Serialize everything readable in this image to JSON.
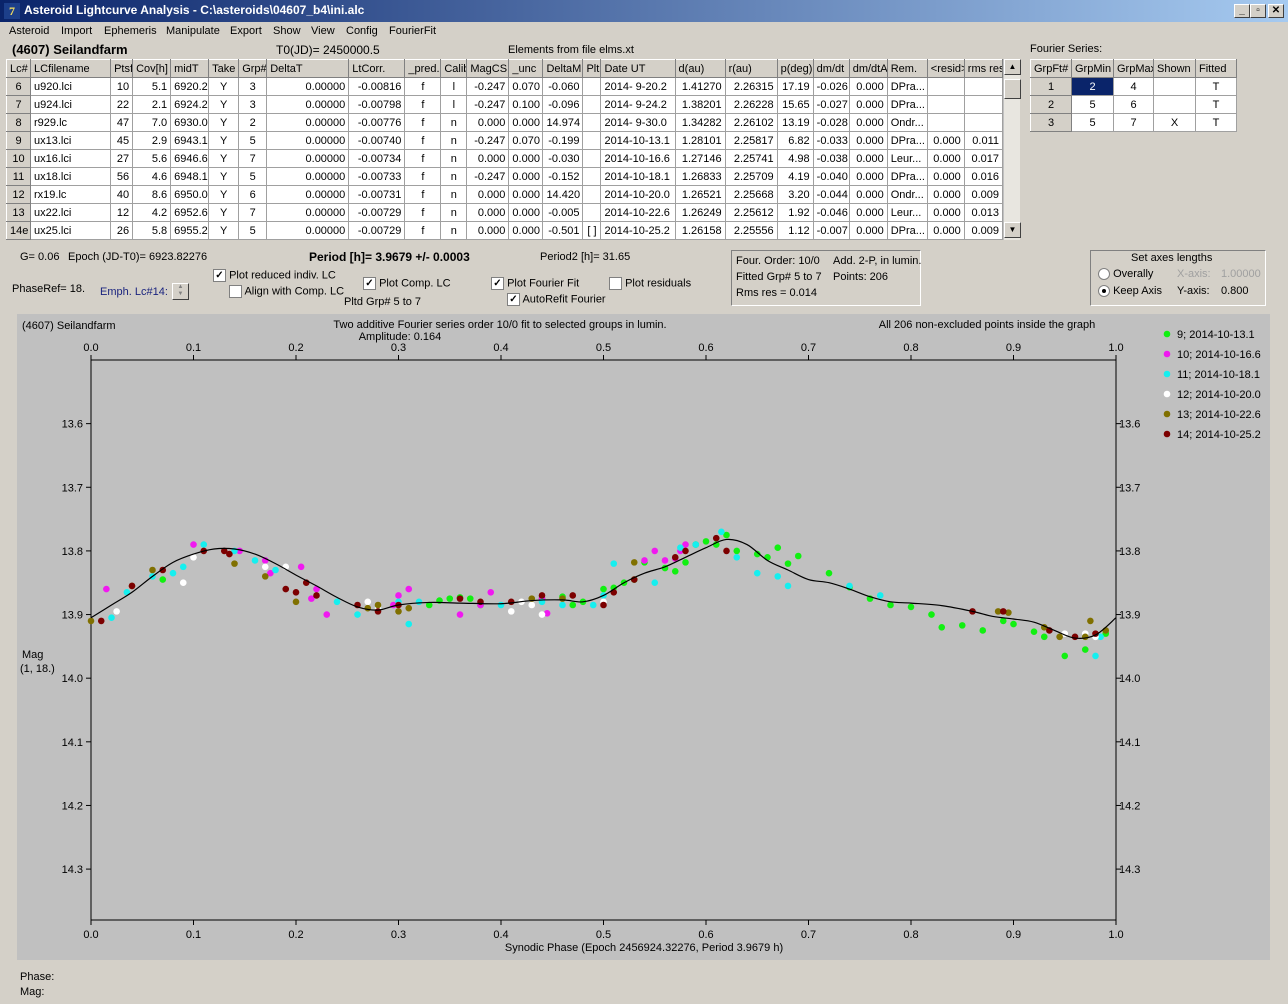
{
  "window": {
    "title": "Asteroid Lightcurve Analysis - C:\\asteroids\\04607_b4\\ini.alc",
    "icon_label": "7",
    "icon_name": "app-logo-icon",
    "controls": [
      "_",
      "▫",
      "✕"
    ]
  },
  "menu": [
    "Asteroid",
    "Import",
    "Ephemeris",
    "Manipulate",
    "Export",
    "Show",
    "View",
    "Config",
    "FourierFit"
  ],
  "header": {
    "asteroid": "(4607) Seilandfarm",
    "t0": "T0(JD)= 2450000.5",
    "elements": "Elements from file elms.xt",
    "fourier_title": "Fourier Series:"
  },
  "lc_table": {
    "columns": [
      "Lc#",
      "LCfilename",
      "Ptsf",
      "Cov[h]",
      "midT",
      "Take",
      "Grp#",
      "DeltaT",
      "LtCorr.",
      "_pred.",
      "Calib",
      "MagCS",
      "_unc",
      "DeltaM",
      "Plt",
      "Date UT",
      "d(au)",
      "r(au)",
      "p(deg)",
      "dm/dt",
      "dm/dtA",
      "Rem.",
      "<resid>",
      "rms res"
    ],
    "rows": [
      [
        "6",
        "u920.lci",
        "10",
        "5.1",
        "6920.2",
        "Y",
        "3",
        "0.00000",
        "-0.00816",
        "f",
        "l",
        "-0.247",
        "0.070",
        "-0.060",
        "",
        "2014- 9-20.2",
        "1.41270",
        "2.26315",
        "17.19",
        "-0.026",
        "0.000",
        "DPra...",
        "",
        ""
      ],
      [
        "7",
        "u924.lci",
        "22",
        "2.1",
        "6924.2",
        "Y",
        "3",
        "0.00000",
        "-0.00798",
        "f",
        "l",
        "-0.247",
        "0.100",
        "-0.096",
        "",
        "2014- 9-24.2",
        "1.38201",
        "2.26228",
        "15.65",
        "-0.027",
        "0.000",
        "DPra...",
        "",
        ""
      ],
      [
        "8",
        "r929.lc",
        "47",
        "7.0",
        "6930.0",
        "Y",
        "2",
        "0.00000",
        "-0.00776",
        "f",
        "n",
        "0.000",
        "0.000",
        "14.974",
        "",
        "2014- 9-30.0",
        "1.34282",
        "2.26102",
        "13.19",
        "-0.028",
        "0.000",
        "Ondr...",
        "",
        ""
      ],
      [
        "9",
        "ux13.lci",
        "45",
        "2.9",
        "6943.1",
        "Y",
        "5",
        "0.00000",
        "-0.00740",
        "f",
        "n",
        "-0.247",
        "0.070",
        "-0.199",
        "",
        "2014-10-13.1",
        "1.28101",
        "2.25817",
        "6.82",
        "-0.033",
        "0.000",
        "DPra...",
        "0.000",
        "0.011"
      ],
      [
        "10",
        "ux16.lci",
        "27",
        "5.6",
        "6946.6",
        "Y",
        "7",
        "0.00000",
        "-0.00734",
        "f",
        "n",
        "0.000",
        "0.000",
        "-0.030",
        "",
        "2014-10-16.6",
        "1.27146",
        "2.25741",
        "4.98",
        "-0.038",
        "0.000",
        "Leur...",
        "0.000",
        "0.017"
      ],
      [
        "11",
        "ux18.lci",
        "56",
        "4.6",
        "6948.1",
        "Y",
        "5",
        "0.00000",
        "-0.00733",
        "f",
        "n",
        "-0.247",
        "0.000",
        "-0.152",
        "",
        "2014-10-18.1",
        "1.26833",
        "2.25709",
        "4.19",
        "-0.040",
        "0.000",
        "DPra...",
        "0.000",
        "0.016"
      ],
      [
        "12",
        "rx19.lc",
        "40",
        "8.6",
        "6950.0",
        "Y",
        "6",
        "0.00000",
        "-0.00731",
        "f",
        "n",
        "0.000",
        "0.000",
        "14.420",
        "",
        "2014-10-20.0",
        "1.26521",
        "2.25668",
        "3.20",
        "-0.044",
        "0.000",
        "Ondr...",
        "0.000",
        "0.009"
      ],
      [
        "13",
        "ux22.lci",
        "12",
        "4.2",
        "6952.6",
        "Y",
        "7",
        "0.00000",
        "-0.00729",
        "f",
        "n",
        "0.000",
        "0.000",
        "-0.005",
        "",
        "2014-10-22.6",
        "1.26249",
        "2.25612",
        "1.92",
        "-0.046",
        "0.000",
        "Leur...",
        "0.000",
        "0.013"
      ],
      [
        "14e",
        "ux25.lci",
        "26",
        "5.8",
        "6955.2",
        "Y",
        "5",
        "0.00000",
        "-0.00729",
        "f",
        "n",
        "0.000",
        "0.000",
        "-0.501",
        "[ ]",
        "2014-10-25.2",
        "1.26158",
        "2.25556",
        "1.12",
        "-0.007",
        "0.000",
        "DPra...",
        "0.000",
        "0.009"
      ]
    ]
  },
  "fourier_table": {
    "columns": [
      "GrpFt#",
      "GrpMin",
      "GrpMax",
      "Shown",
      "Fitted"
    ],
    "rows": [
      [
        "1",
        "2",
        "4",
        "",
        "T"
      ],
      [
        "2",
        "5",
        "6",
        "",
        "T"
      ],
      [
        "3",
        "5",
        "7",
        "X",
        "T"
      ]
    ]
  },
  "controls": {
    "g": "G= 0.06",
    "epoch": "Epoch (JD-T0)= 6923.82276",
    "period": "Period [h]= 3.9679 +/- 0.0003",
    "period2": "Period2 [h]= 31.65",
    "phase_ref": "PhaseRef= 18.",
    "emph_lc": "Emph. Lc#14:",
    "plot_reduced": "Plot reduced indiv. LC",
    "align_comp": "Align with Comp. LC",
    "plot_comp": "Plot Comp. LC",
    "pltd_grp": "Pltd Grp#  5  to  7",
    "plot_fourier": "Plot Fourier Fit",
    "autorefit": "AutoRefit Fourier",
    "plot_residuals": "Plot residuals",
    "checked": {
      "plot_reduced": true,
      "align_comp": false,
      "plot_comp": true,
      "plot_fourier": true,
      "autorefit": true,
      "plot_residuals": false
    },
    "check_mark": "✓",
    "fit_info": {
      "order": "Four. Order: 10/0",
      "add": "Add. 2-P, in lumin.",
      "fitted": "Fitted Grp# 5 to 7",
      "points": "Points: 206",
      "rms": "Rms res     = 0.014"
    },
    "axes": {
      "title": "Set axes lengths",
      "overally": "Overally",
      "keep": "Keep Axis",
      "selected": "keep",
      "x_label": "X-axis:",
      "x_value": "1.00000",
      "y_label": "Y-axis:",
      "y_value": "0.800"
    }
  },
  "chart_data": {
    "type": "scatter",
    "name_text": "(4607) Seilandfarm",
    "title": "Two additive Fourier series order 10/0 fit to selected groups in lumin.",
    "subtitle": "Amplitude: 0.164",
    "note": "All 206 non-excluded points inside the graph",
    "xlabel": "Synodic Phase (Epoch 2456924.32276, Period 3.9679 h)",
    "ylabel": "Mag",
    "ylabel2": "(1, 18.)",
    "xlim": [
      0.0,
      1.0
    ],
    "ylim": [
      13.5,
      14.38
    ],
    "y_inverted": true,
    "x_ticks": [
      "0.0",
      "0.1",
      "0.2",
      "0.3",
      "0.4",
      "0.5",
      "0.6",
      "0.7",
      "0.8",
      "0.9",
      "1.0"
    ],
    "y_ticks": [
      "13.6",
      "13.7",
      "13.8",
      "13.9",
      "14.0",
      "14.1",
      "14.2",
      "14.3"
    ],
    "grid": false,
    "legend_position": "right",
    "fit_curve": {
      "color": "#000000",
      "x": [
        0.0,
        0.02,
        0.04,
        0.06,
        0.08,
        0.1,
        0.12,
        0.14,
        0.16,
        0.18,
        0.2,
        0.22,
        0.24,
        0.26,
        0.28,
        0.3,
        0.33,
        0.36,
        0.4,
        0.43,
        0.46,
        0.48,
        0.5,
        0.52,
        0.54,
        0.56,
        0.58,
        0.6,
        0.62,
        0.64,
        0.66,
        0.68,
        0.7,
        0.72,
        0.74,
        0.76,
        0.78,
        0.8,
        0.83,
        0.86,
        0.88,
        0.9,
        0.92,
        0.94,
        0.96,
        0.98,
        1.0
      ],
      "y": [
        13.905,
        13.885,
        13.865,
        13.84,
        13.818,
        13.805,
        13.797,
        13.797,
        13.805,
        13.82,
        13.838,
        13.855,
        13.873,
        13.888,
        13.893,
        13.885,
        13.881,
        13.882,
        13.883,
        13.878,
        13.877,
        13.88,
        13.87,
        13.85,
        13.835,
        13.825,
        13.81,
        13.795,
        13.782,
        13.79,
        13.815,
        13.83,
        13.845,
        13.85,
        13.86,
        13.872,
        13.88,
        13.882,
        13.886,
        13.895,
        13.903,
        13.907,
        13.912,
        13.925,
        13.937,
        13.932,
        13.905
      ]
    },
    "series": [
      {
        "name": "9; 2014-10-13.1",
        "color": "#11f011",
        "x": [
          0.07,
          0.33,
          0.34,
          0.35,
          0.36,
          0.37,
          0.38,
          0.44,
          0.46,
          0.47,
          0.48,
          0.5,
          0.51,
          0.52,
          0.53,
          0.54,
          0.56,
          0.57,
          0.58,
          0.59,
          0.6,
          0.61,
          0.62,
          0.63,
          0.65,
          0.66,
          0.67,
          0.68,
          0.69,
          0.72,
          0.74,
          0.76,
          0.78,
          0.8,
          0.82,
          0.83,
          0.85,
          0.87,
          0.89,
          0.9,
          0.92,
          0.93,
          0.95,
          0.97,
          0.99
        ],
        "y": [
          13.845,
          13.885,
          13.878,
          13.875,
          13.873,
          13.875,
          13.885,
          13.875,
          13.872,
          13.885,
          13.88,
          13.86,
          13.858,
          13.85,
          13.845,
          13.818,
          13.827,
          13.832,
          13.818,
          13.79,
          13.785,
          13.79,
          13.775,
          13.8,
          13.805,
          13.81,
          13.795,
          13.82,
          13.808,
          13.835,
          13.857,
          13.875,
          13.885,
          13.888,
          13.9,
          13.92,
          13.917,
          13.925,
          13.91,
          13.915,
          13.927,
          13.935,
          13.965,
          13.955,
          13.93
        ]
      },
      {
        "name": "10; 2014-10-16.6",
        "color": "#f019f0",
        "x": [
          0.015,
          0.1,
          0.145,
          0.17,
          0.175,
          0.205,
          0.215,
          0.22,
          0.23,
          0.295,
          0.3,
          0.31,
          0.36,
          0.38,
          0.39,
          0.44,
          0.445,
          0.54,
          0.55,
          0.56,
          0.57,
          0.575,
          0.58
        ],
        "y": [
          13.86,
          13.79,
          13.8,
          13.815,
          13.835,
          13.825,
          13.875,
          13.86,
          13.9,
          13.885,
          13.87,
          13.86,
          13.9,
          13.885,
          13.865,
          13.875,
          13.898,
          13.815,
          13.8,
          13.815,
          13.812,
          13.8,
          13.79
        ]
      },
      {
        "name": "11; 2014-10-18.1",
        "color": "#15efef",
        "x": [
          0.02,
          0.035,
          0.06,
          0.08,
          0.09,
          0.11,
          0.14,
          0.16,
          0.18,
          0.24,
          0.26,
          0.28,
          0.3,
          0.31,
          0.32,
          0.4,
          0.44,
          0.46,
          0.49,
          0.5,
          0.51,
          0.55,
          0.575,
          0.59,
          0.61,
          0.615,
          0.63,
          0.65,
          0.67,
          0.68,
          0.74,
          0.77,
          0.98,
          0.985
        ],
        "y": [
          13.905,
          13.865,
          13.84,
          13.835,
          13.825,
          13.79,
          13.8,
          13.815,
          13.83,
          13.88,
          13.9,
          13.89,
          13.88,
          13.915,
          13.88,
          13.885,
          13.88,
          13.885,
          13.885,
          13.87,
          13.82,
          13.85,
          13.795,
          13.79,
          13.78,
          13.77,
          13.81,
          13.835,
          13.84,
          13.855,
          13.855,
          13.87,
          13.965,
          13.935
        ]
      },
      {
        "name": "12; 2014-10-20.0",
        "color": "#ffffff",
        "x": [
          0.025,
          0.09,
          0.1,
          0.17,
          0.19,
          0.27,
          0.28,
          0.3,
          0.41,
          0.42,
          0.43,
          0.44,
          0.5,
          0.95,
          0.97,
          0.98
        ],
        "y": [
          13.895,
          13.85,
          13.81,
          13.825,
          13.825,
          13.88,
          13.89,
          13.885,
          13.895,
          13.88,
          13.885,
          13.9,
          13.88,
          13.93,
          13.93,
          13.935
        ]
      },
      {
        "name": "13; 2014-10-22.6",
        "color": "#807000",
        "x": [
          0.0,
          0.04,
          0.06,
          0.14,
          0.17,
          0.2,
          0.27,
          0.28,
          0.3,
          0.31,
          0.43,
          0.46,
          0.53,
          0.885,
          0.895,
          0.93,
          0.945,
          0.97,
          0.975,
          0.99
        ],
        "y": [
          13.91,
          13.855,
          13.83,
          13.82,
          13.84,
          13.88,
          13.89,
          13.885,
          13.895,
          13.89,
          13.875,
          13.875,
          13.818,
          13.895,
          13.897,
          13.92,
          13.935,
          13.935,
          13.91,
          13.925
        ]
      },
      {
        "name": "14; 2014-10-25.2",
        "color": "#7c0000",
        "x": [
          0.01,
          0.04,
          0.07,
          0.11,
          0.13,
          0.135,
          0.19,
          0.2,
          0.21,
          0.22,
          0.26,
          0.28,
          0.3,
          0.36,
          0.38,
          0.41,
          0.44,
          0.47,
          0.5,
          0.51,
          0.53,
          0.57,
          0.58,
          0.61,
          0.62,
          0.86,
          0.89,
          0.935,
          0.96,
          0.98
        ],
        "y": [
          13.91,
          13.855,
          13.83,
          13.8,
          13.8,
          13.805,
          13.86,
          13.865,
          13.85,
          13.87,
          13.885,
          13.895,
          13.885,
          13.875,
          13.88,
          13.88,
          13.87,
          13.87,
          13.885,
          13.865,
          13.845,
          13.81,
          13.8,
          13.78,
          13.8,
          13.895,
          13.895,
          13.925,
          13.935,
          13.93
        ]
      }
    ]
  },
  "status": {
    "phase": "Phase:",
    "mag": "Mag:"
  }
}
